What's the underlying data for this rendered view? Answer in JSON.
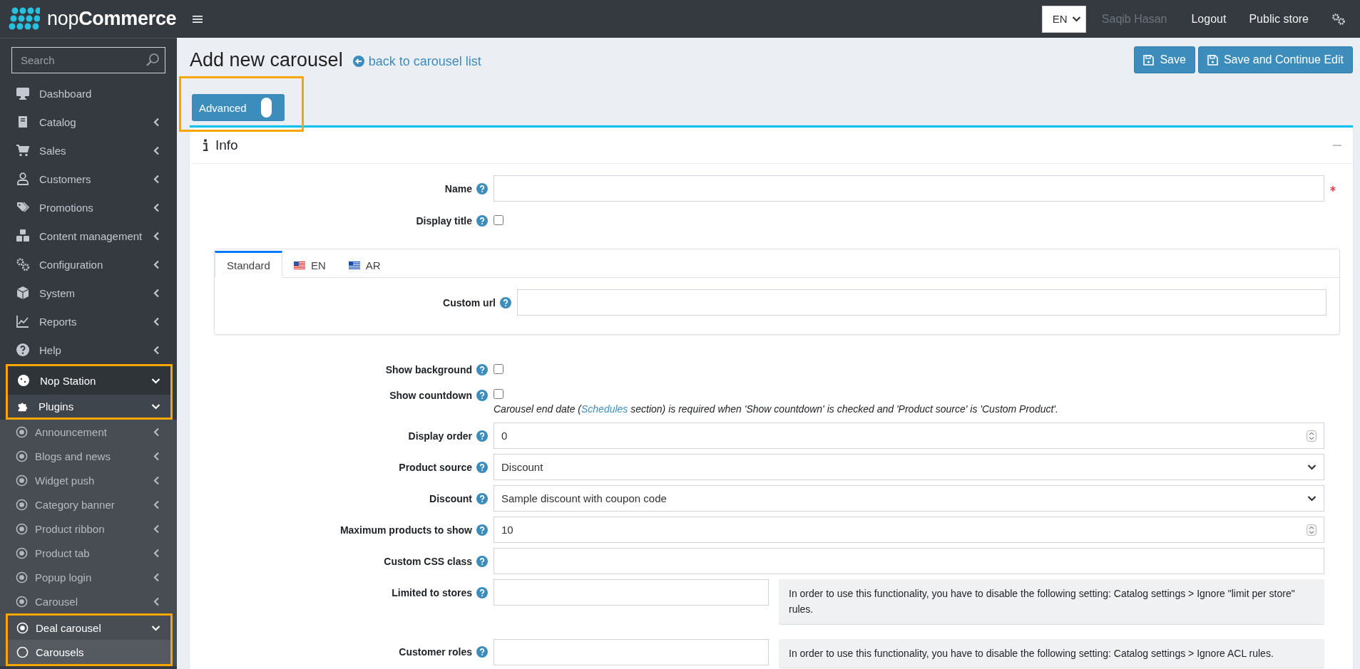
{
  "brand": {
    "name": "nop**Commerce**"
  },
  "sidebar": {
    "search_placeholder": "Search",
    "items": [
      {
        "label": "Dashboard",
        "selected": false
      },
      {
        "label": "Catalog",
        "expanded": false,
        "selected": false
      },
      {
        "label": "Sales",
        "expanded": false,
        "selected": false
      },
      {
        "label": "Customers",
        "expanded": false,
        "selected": false
      },
      {
        "label": "Promotions",
        "expanded": false,
        "selected": false
      },
      {
        "label": "Content management",
        "expanded": false,
        "selected": false
      },
      {
        "label": "Configuration",
        "expanded": false,
        "selected": false
      },
      {
        "label": "System",
        "expanded": false,
        "selected": false
      },
      {
        "label": "Reports",
        "expanded": false,
        "selected": false
      },
      {
        "label": "Help",
        "expanded": false,
        "selected": false
      },
      {
        "label": "Nop Station",
        "expanded": true,
        "selected": false,
        "highlighted": true,
        "children": [
          {
            "label": "Plugins",
            "expanded": true,
            "selected": false,
            "highlighted": true,
            "children": [
              {
                "label": "Announcement",
                "expanded": false,
                "selected": false
              },
              {
                "label": "Blogs and news",
                "expanded": false,
                "selected": false
              },
              {
                "label": "Widget push",
                "expanded": false,
                "selected": false
              },
              {
                "label": "Category banner",
                "expanded": false,
                "selected": false
              },
              {
                "label": "Product ribbon",
                "expanded": false,
                "selected": false
              },
              {
                "label": "Product tab",
                "expanded": false,
                "selected": false
              },
              {
                "label": "Popup login",
                "expanded": false,
                "selected": false
              },
              {
                "label": "Carousel",
                "expanded": false,
                "selected": false
              },
              {
                "label": "Deal carousel",
                "expanded": true,
                "selected": false,
                "highlighted": true,
                "children": [
                  {
                    "label": "Carousels",
                    "selected": true,
                    "highlighted": true
                  }
                ]
              }
            ]
          }
        ]
      }
    ]
  },
  "topbar": {
    "language": "EN",
    "user": "Saqib Hasan",
    "links": [
      "Logout",
      "Public store"
    ]
  },
  "page": {
    "title": "Add new carousel",
    "back_link": "back to carousel list",
    "buttons": [
      "Save",
      "Save and Continue Edit"
    ]
  },
  "advanced_toggle": {
    "label": "Advanced",
    "on": true,
    "highlighted": true
  },
  "card": {
    "title": "Info",
    "expanded": true,
    "fields": [
      {
        "kind": "text",
        "label": "Name",
        "required": true
      },
      {
        "kind": "checkbox",
        "label": "Display title",
        "checked": false
      },
      {
        "kind": "tabs",
        "tabs": [
          {
            "label": "Standard",
            "selected": true
          },
          {
            "label": "EN",
            "selected": false
          },
          {
            "label": "AR",
            "selected": false
          }
        ],
        "field": {
          "label": "Custom url"
        }
      },
      {
        "kind": "checkbox",
        "label": "Show background",
        "checked": false
      },
      {
        "kind": "checkbox",
        "label": "Show countdown",
        "checked": false,
        "note": {
          "before": "Carousel end date (",
          "link": "Schedules",
          "after": " section) is required when 'Show countdown' is checked and 'Product source' is 'Custom Product'."
        }
      },
      {
        "kind": "number",
        "label": "Display order",
        "value": "0"
      },
      {
        "kind": "select",
        "label": "Product source",
        "value": "Discount"
      },
      {
        "kind": "select",
        "label": "Discount",
        "value": "Sample discount with coupon code"
      },
      {
        "kind": "number",
        "label": "Maximum products to show",
        "value": "10"
      },
      {
        "kind": "text",
        "label": "Custom CSS class",
        "required": false
      },
      {
        "kind": "restricted",
        "label": "Limited to stores",
        "note": "In order to use this functionality, you have to disable the following setting: Catalog settings > Ignore \"limit per store\" rules."
      },
      {
        "kind": "restricted",
        "label": "Customer roles",
        "note": "In order to use this functionality, you have to disable the following setting: Catalog settings > Ignore ACL rules."
      }
    ]
  }
}
